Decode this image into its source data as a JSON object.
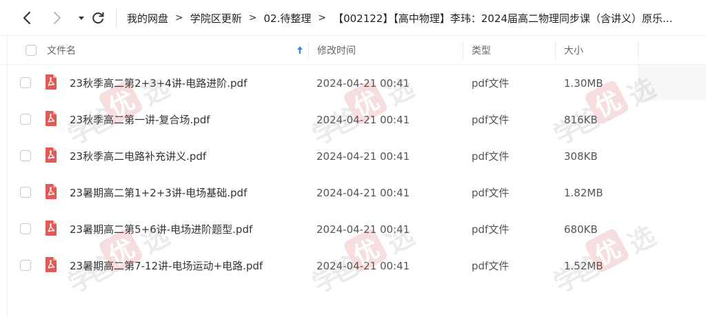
{
  "toolbar": {
    "back_icon": "chevron-left-icon",
    "forward_icon": "chevron-right-icon",
    "dropdown_icon": "caret-down-icon",
    "refresh_icon": "refresh-icon"
  },
  "breadcrumb": {
    "items": [
      "我的网盘",
      "学院区更新",
      "02.待整理",
      "【002122】【高中物理】李玮：2024届高二物理同步课（含讲义）原乐..."
    ],
    "separator": ">"
  },
  "table": {
    "select_all_checked": false,
    "columns": {
      "name": "文件名",
      "time": "修改时间",
      "type": "类型",
      "size": "大小"
    },
    "sort": {
      "column": "name",
      "direction": "ascending",
      "icon": "arrow-up-icon"
    },
    "file_icon": "pdf-icon",
    "rows": [
      {
        "name": "23秋季高二第2+3+4讲-电路进阶.pdf",
        "time": "2024-04-21 00:41",
        "type": "pdf文件",
        "size": "1.30MB"
      },
      {
        "name": "23秋季高二第一讲-复合场.pdf",
        "time": "2024-04-21 00:41",
        "type": "pdf文件",
        "size": "816KB"
      },
      {
        "name": "23秋季高二电路补充讲义.pdf",
        "time": "2024-04-21 00:41",
        "type": "pdf文件",
        "size": "308KB"
      },
      {
        "name": "23暑期高二第1+2+3讲-电场基础.pdf",
        "time": "2024-04-21 00:41",
        "type": "pdf文件",
        "size": "1.82MB"
      },
      {
        "name": "23暑期高二第5+6讲-电场进阶题型.pdf",
        "time": "2024-04-21 00:41",
        "type": "pdf文件",
        "size": "680KB"
      },
      {
        "name": "23暑期高二第7-12讲-电场运动+电路.pdf",
        "time": "2024-04-21 00:41",
        "type": "pdf文件",
        "size": "1.52MB"
      }
    ]
  },
  "watermark": {
    "chars": [
      "学",
      "爸",
      "优",
      "选"
    ]
  },
  "colors": {
    "pdf_red": "#e15a58",
    "sort_arrow": "#2f8cf0",
    "watermark_red": "#d33a3a"
  }
}
